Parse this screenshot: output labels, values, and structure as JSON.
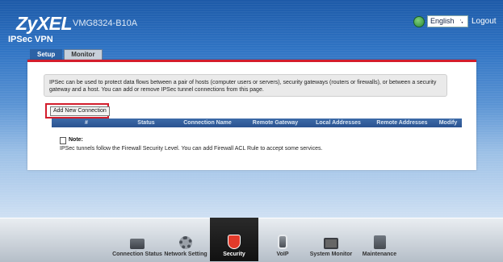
{
  "header": {
    "brand": "ZyXEL",
    "model": "VMG8324-B10A",
    "language": "English",
    "logout_label": "Logout"
  },
  "page": {
    "title": "IPSec VPN"
  },
  "tabs": [
    {
      "label": "Setup",
      "active": true
    },
    {
      "label": "Monitor",
      "active": false
    }
  ],
  "panel": {
    "description": "IPSec can be used to protect data flows between a pair of hosts (computer users or servers), security gateways (routers or firewalls), or between a security gateway and a host. You can add or remove IPSec tunnel connections from this page.",
    "add_button": "Add New Connection",
    "columns": [
      "#",
      "Status",
      "Connection Name",
      "Remote Gateway",
      "Local Addresses",
      "Remote Addresses",
      "Modify"
    ],
    "note_label": "Note:",
    "note_text": "IPSec tunnels follow the Firewall Security Level. You can add Firewall ACL Rule to accept some services."
  },
  "nav": [
    {
      "label": "Connection Status",
      "icon": "connection-status-icon",
      "active": false
    },
    {
      "label": "Network Setting",
      "icon": "gear-icon",
      "active": false
    },
    {
      "label": "Security",
      "icon": "shield-icon",
      "active": true
    },
    {
      "label": "VoIP",
      "icon": "phone-icon",
      "active": false
    },
    {
      "label": "System Monitor",
      "icon": "monitor-icon",
      "active": false
    },
    {
      "label": "Maintenance",
      "icon": "maintenance-icon",
      "active": false
    }
  ],
  "colors": {
    "accent_red": "#d31d2c",
    "header_blue": "#2f73c3",
    "table_header": "#2a5290"
  }
}
